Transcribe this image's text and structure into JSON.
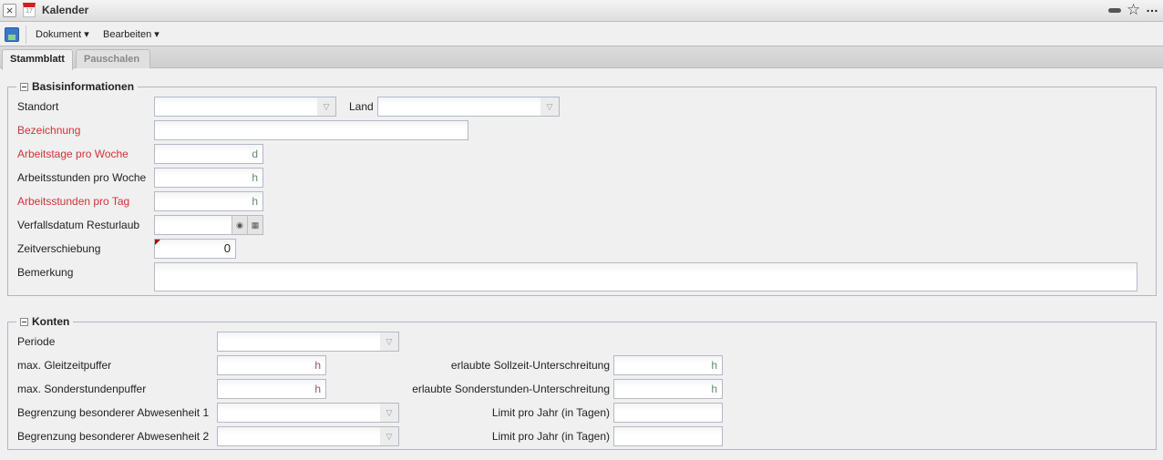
{
  "window": {
    "title": "Kalender"
  },
  "menu": {
    "dokument": "Dokument ▾",
    "bearbeiten": "Bearbeiten ▾"
  },
  "tabs": [
    "Stammblatt",
    "Pauschalen"
  ],
  "basis": {
    "legend": "Basisinformationen",
    "standort": "Standort",
    "land": "Land",
    "bezeichnung": "Bezeichnung",
    "arbeitstage": "Arbeitstage pro Woche",
    "arbeitstage_unit": "d",
    "stunden_woche": "Arbeitsstunden pro Woche",
    "stunden_woche_unit": "h",
    "stunden_tag": "Arbeitsstunden pro Tag",
    "stunden_tag_unit": "h",
    "verfall": "Verfallsdatum Resturlaub",
    "zeitversch": "Zeitverschiebung",
    "zeitversch_value": "0",
    "bemerkung": "Bemerkung"
  },
  "konten": {
    "legend": "Konten",
    "periode": "Periode",
    "gleitzeit": "max. Gleitzeitpuffer",
    "gleitzeit_unit": "h",
    "sonderstunden": "max. Sonderstundenpuffer",
    "sonderstunden_unit": "h",
    "abw1": "Begrenzung besonderer Abwesenheit 1",
    "abw2": "Begrenzung besonderer Abwesenheit 2",
    "sollzeit": "erlaubte Sollzeit-Unterschreitung",
    "sollzeit_unit": "h",
    "sonder_unter": "erlaubte Sonderstunden-Unterschreitung",
    "sonder_unter_unit": "h",
    "limit1": "Limit pro Jahr (in Tagen)",
    "limit2": "Limit pro Jahr (in Tagen)"
  }
}
